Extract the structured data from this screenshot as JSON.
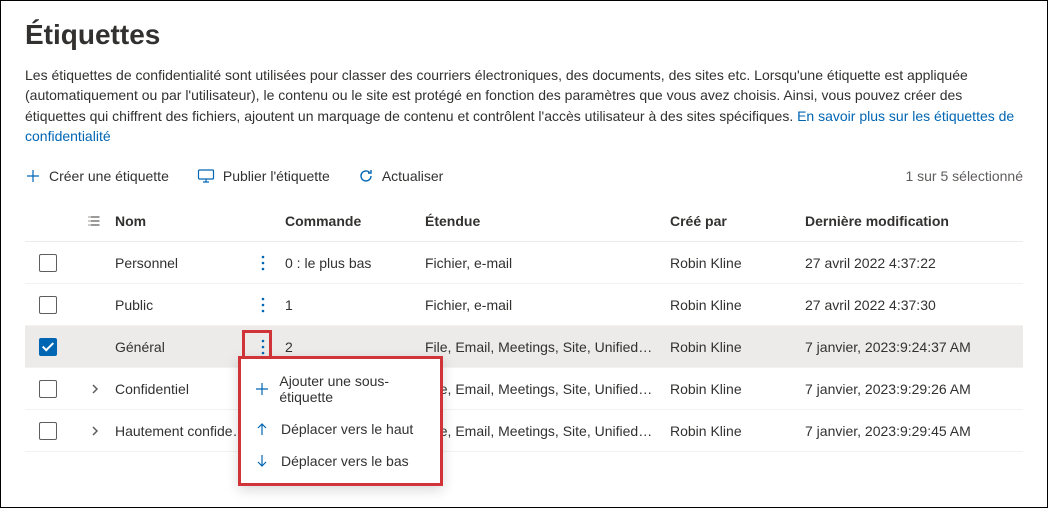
{
  "page": {
    "title": "Étiquettes",
    "description_1": "Les étiquettes de confidentialité sont utilisées pour classer des courriers électroniques, des documents, des sites etc. Lorsqu'une étiquette est appliquée (automatiquement ou par l'utilisateur), le contenu ou le site est protégé en fonction des paramètres que vous avez choisis. Ainsi, vous pouvez créer des étiquettes qui chiffrent des fichiers, ajoutent un marquage de contenu et contrôlent l'accès utilisateur à des sites spécifiques. ",
    "learn_more": "En savoir plus sur les étiquettes de confidentialité"
  },
  "toolbar": {
    "create": "Créer une étiquette",
    "publish": "Publier l'étiquette",
    "refresh": "Actualiser",
    "selection": "1 sur 5 sélectionné"
  },
  "columns": {
    "name": "Nom",
    "order": "Commande",
    "scope": "Étendue",
    "createdBy": "Créé par",
    "modified": "Dernière modification"
  },
  "rows": [
    {
      "name": "Personnel",
      "order": "0 : le plus bas",
      "scope": "Fichier, e-mail",
      "createdBy": "Robin Kline",
      "modified": "27 avril 2022 4:37:22",
      "expandable": false,
      "checked": false
    },
    {
      "name": "Public",
      "order": "1",
      "scope": "Fichier, e-mail",
      "createdBy": "Robin Kline",
      "modified": "27 avril 2022 4:37:30",
      "expandable": false,
      "checked": false
    },
    {
      "name": "Général",
      "order": "2",
      "scope": "File, Email, Meetings, Site, UnifiedGroup",
      "createdBy": "Robin Kline",
      "modified": "7 janvier, 2023:9:24:37 AM",
      "expandable": false,
      "checked": true
    },
    {
      "name": "Confidentiel",
      "order": "",
      "scope": "File, Email, Meetings, Site, UnifiedGroup",
      "createdBy": "Robin Kline",
      "modified": "7 janvier, 2023:9:29:26 AM",
      "expandable": true,
      "checked": false
    },
    {
      "name": "Hautement confidentiel",
      "order": "",
      "scope": "File, Email, Meetings, Site, UnifiedGroup",
      "createdBy": "Robin Kline",
      "modified": "7 janvier, 2023:9:29:45 AM",
      "expandable": true,
      "checked": false
    }
  ],
  "menu": {
    "addSub": "Ajouter une sous-étiquette",
    "moveUp": "Déplacer vers le haut",
    "moveDown": "Déplacer vers le bas"
  }
}
